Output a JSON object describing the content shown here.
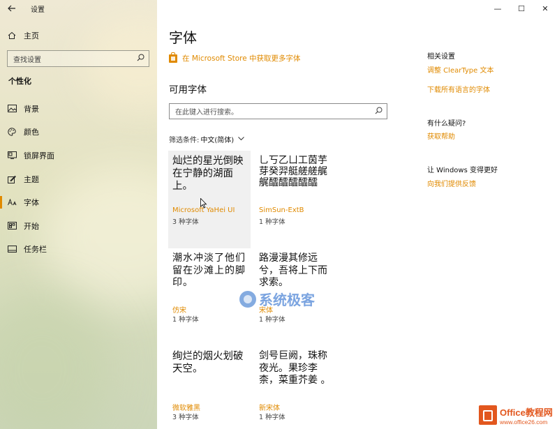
{
  "app": {
    "title": "设置"
  },
  "sidebar": {
    "home_label": "主页",
    "search_placeholder": "查找设置",
    "section_heading": "个性化",
    "items": [
      {
        "label": "背景",
        "icon": "background-icon"
      },
      {
        "label": "颜色",
        "icon": "palette-icon"
      },
      {
        "label": "锁屏界面",
        "icon": "lock-screen-icon"
      },
      {
        "label": "主题",
        "icon": "themes-icon"
      },
      {
        "label": "字体",
        "icon": "fonts-icon",
        "active": true
      },
      {
        "label": "开始",
        "icon": "start-icon"
      },
      {
        "label": "任务栏",
        "icon": "taskbar-icon"
      }
    ]
  },
  "window_controls": {
    "minimize": "—",
    "maximize": "☐",
    "close": "✕"
  },
  "main": {
    "title": "字体",
    "store_link": "在 Microsoft Store 中获取更多字体",
    "available_title": "可用字体",
    "search_placeholder": "在此键入进行搜索。",
    "filter_label": "筛选条件:",
    "filter_value": "中文(简体)",
    "fonts": [
      {
        "preview": "灿烂的星光倒映在宁静的湖面上。",
        "name": "Microsoft YaHei UI",
        "count": "3 种字体"
      },
      {
        "preview": "乚丂乙ㄩ工茵芋芽癸羿艇艖艖艉艉醽醽醽醽醽",
        "name": "SimSun-ExtB",
        "count": "1 种字体"
      },
      {
        "preview": "潮水冲淡了他们留在沙滩上的脚印。",
        "name": "仿宋",
        "count": "1 种字体"
      },
      {
        "preview": "路漫漫其修远兮，吾将上下而求索。",
        "name": "宋体",
        "count": "1 种字体"
      },
      {
        "preview": "绚烂的烟火划破天空。",
        "name": "微软雅黑",
        "count": "3 种字体"
      },
      {
        "preview": "剑号巨阙，珠称夜光。果珍李柰，菜重芥姜 。",
        "name": "新宋体",
        "count": "1 种字体"
      }
    ]
  },
  "related": {
    "heading": "相关设置",
    "links": [
      "调整 ClearType 文本",
      "下载所有语言的字体"
    ],
    "question_heading": "有什么疑问?",
    "help_link": "获取帮助",
    "improve_heading": "让 Windows 变得更好",
    "feedback_link": "向我们提供反馈"
  },
  "watermark": {
    "text": "系统极客"
  },
  "badge": {
    "brand": "Office教程网",
    "url": "www.office26.com"
  },
  "colors": {
    "accent": "#e08a00",
    "brand_badge": "#e2571e"
  }
}
